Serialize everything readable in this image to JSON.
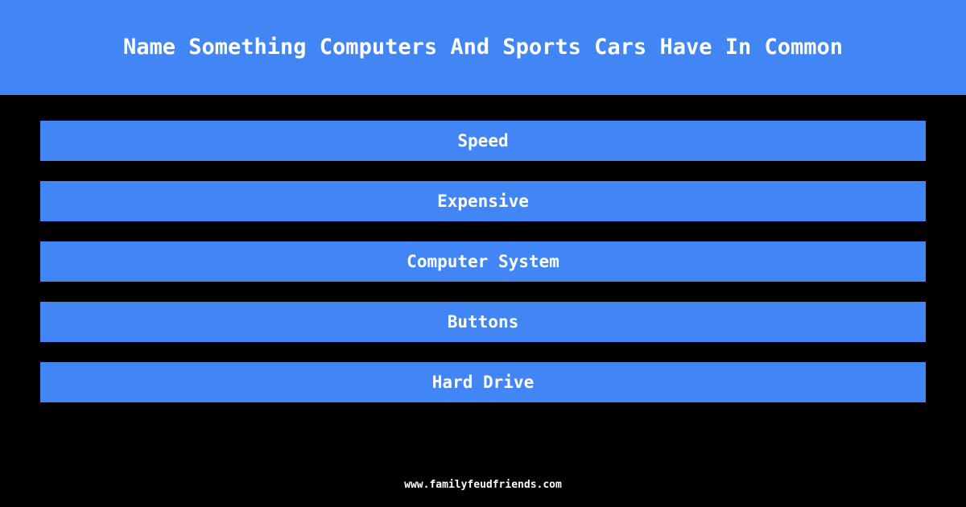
{
  "theme": {
    "background_color": "#000000",
    "accent_color": "#4285f4",
    "text_color": "#ffffff"
  },
  "header": {
    "title": "Name Something Computers And Sports Cars Have In Common"
  },
  "answers": [
    {
      "rank": 1,
      "text": "Speed"
    },
    {
      "rank": 2,
      "text": "Expensive"
    },
    {
      "rank": 3,
      "text": "Computer System"
    },
    {
      "rank": 4,
      "text": "Buttons"
    },
    {
      "rank": 5,
      "text": "Hard Drive"
    }
  ],
  "footer": {
    "url": "www.familyfeudfriends.com"
  }
}
